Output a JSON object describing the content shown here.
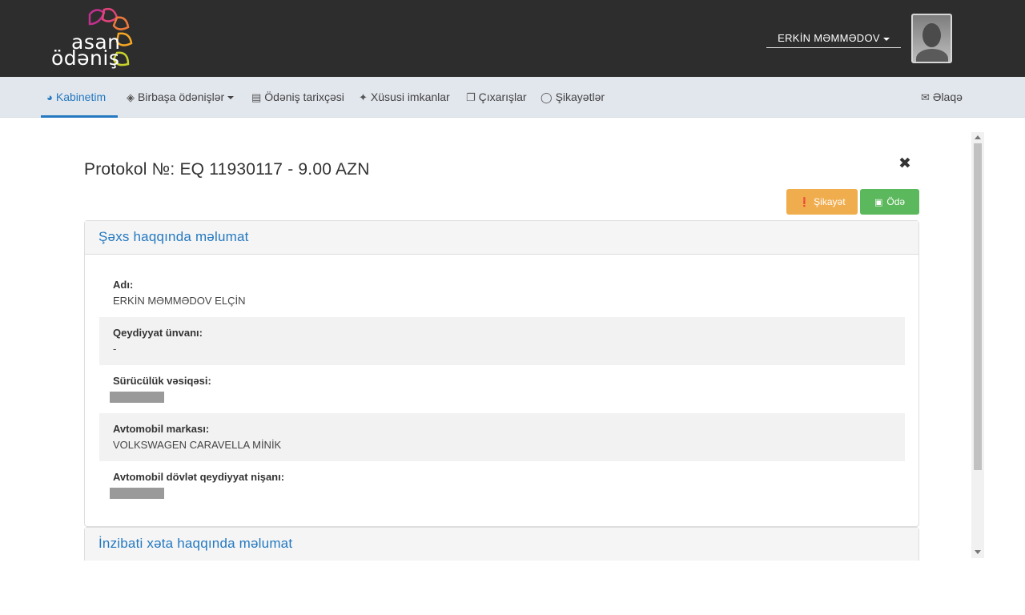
{
  "header": {
    "logo_line1": "asan",
    "logo_line2": "ödəniş",
    "user_name": "ERKİN MƏMMƏDOV"
  },
  "nav": {
    "items": [
      {
        "label": "Kabinetim",
        "icon": "dashboard-icon",
        "active": true
      },
      {
        "label": "Birbaşa ödənişlər",
        "icon": "cube-icon",
        "dropdown": true
      },
      {
        "label": "Ödəniş tarixçəsi",
        "icon": "list-icon"
      },
      {
        "label": "Xüsusi imkanlar",
        "icon": "magic-wand-icon"
      },
      {
        "label": "Çıxarışlar",
        "icon": "copy-icon"
      },
      {
        "label": "Şikayətlər",
        "icon": "chat-icon"
      }
    ],
    "contact_label": "Əlaqə",
    "accent_color": "#2479c1"
  },
  "modal": {
    "title": "Protokol №: EQ 11930117 - 9.00 AZN",
    "complaint_button": "Şikayət",
    "pay_button": "Ödə",
    "person_panel": {
      "heading": "Şəxs haqqında məlumat",
      "fields": [
        {
          "label": "Adı:",
          "value": "ERKİN MƏMMƏDOV ELÇİN"
        },
        {
          "label": "Qeydiyyat ünvanı:",
          "value": "-"
        },
        {
          "label": "Sürücülük vəsiqəsi:",
          "value": "",
          "redacted": true
        },
        {
          "label": "Avtomobil markası:",
          "value": "VOLKSWAGEN CARAVELLA MİNİK"
        },
        {
          "label": "Avtomobil dövlət qeydiyyat nişanı:",
          "value": "",
          "redacted": true
        }
      ]
    },
    "violation_panel": {
      "heading": "İnzibati xəta haqqında məlumat"
    }
  }
}
